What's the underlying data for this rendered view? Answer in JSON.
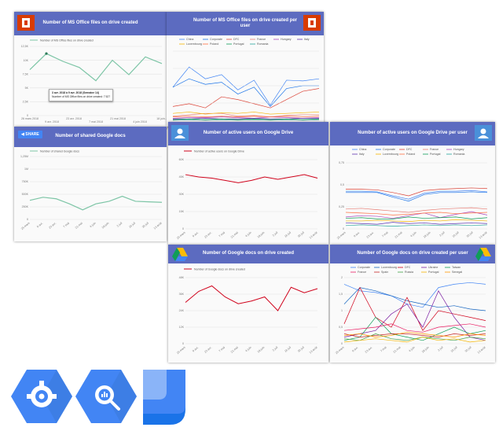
{
  "colors": {
    "header": "#5c6bc0",
    "office": "#d83b01",
    "teal": "#7dc5a6",
    "red": "#d0021b"
  },
  "cards": {
    "ms_office": {
      "title": "Number of MS Office files on drive created",
      "icon": "office-icon"
    },
    "ms_office_user": {
      "title": "Number of MS Office files on drive created per user",
      "icon": "office-icon"
    },
    "shared_docs": {
      "title": "Number of shared Google docs",
      "share_label": "SHARE"
    },
    "active_users": {
      "title": "Number of active users on Google Drive",
      "icon": "user-icon"
    },
    "active_users_per_user": {
      "title": "Number of active users on Google Drive per user",
      "icon": "user-icon"
    },
    "docs_created": {
      "title": "Number of Google docs on drive created",
      "icon": "drive-icon"
    },
    "docs_created_user": {
      "title": "Number of Google docs on drive created per user",
      "icon": "drive-icon"
    }
  },
  "tooltip": {
    "line1": "3 avr. 2018 à 9 avr. 2018 (Semaine 14)",
    "line2": "Number of MS Office files on drive created: 7 527"
  },
  "chart_data": [
    {
      "type": "line",
      "title": "Number of MS Office files on drive created",
      "series": [
        {
          "name": "Number of MS Office files on drive created",
          "values": [
            8.3,
            11.2,
            9.8,
            8.7,
            6.3,
            10.0,
            7.4,
            10.6,
            9.4
          ]
        }
      ],
      "yticks": [
        "0",
        "2,5K",
        "5K",
        "7,5K",
        "10K",
        "12,5K"
      ],
      "ylim": [
        0,
        12.5
      ],
      "xticks": [
        "26 mars 2018",
        "9 avr. 2018",
        "23 avr. 2018",
        "7 mai 2018",
        "21 mai 2018",
        "4 juin 2018",
        "18 juin..."
      ]
    },
    {
      "type": "line",
      "title": "Number of MS Office files on drive created per user",
      "legend": [
        "China",
        "Corporate",
        "DFC",
        "France",
        "Hungary",
        "Italy",
        "Luxembourg",
        "Poland",
        "Portugal",
        "Romania"
      ],
      "ylim": [
        0,
        1
      ]
    },
    {
      "type": "line",
      "title": "Number of shared Google docs",
      "series": [
        {
          "name": "Number of shared Google docs",
          "values": [
            0.38,
            0.44,
            0.41,
            0.31,
            0.19,
            0.31,
            0.36,
            0.46,
            0.36,
            0.35,
            0.34
          ]
        }
      ],
      "yticks": [
        "0",
        "250K",
        "500K",
        "750K",
        "1M",
        "1,25M"
      ],
      "ylim": [
        0,
        1.25
      ]
    },
    {
      "type": "line",
      "title": "Number of active users on Google Drive",
      "series": [
        {
          "name": "Number of active users on Google Drive",
          "values": [
            47,
            45,
            44,
            42,
            40,
            42,
            45,
            43,
            45,
            47,
            44
          ]
        }
      ],
      "yticks": [
        "0",
        "15K",
        "30K",
        "45K",
        "60K"
      ],
      "ylim": [
        0,
        60
      ]
    },
    {
      "type": "line",
      "title": "Number of active users on Google Drive per user",
      "legend": [
        "China",
        "Corporate",
        "DFC",
        "France",
        "Hungary",
        "Italy",
        "Luxembourg",
        "Poland",
        "Portugal",
        "Romania"
      ],
      "yticks": [
        "0",
        "0,25",
        "0,5",
        "0,75"
      ],
      "ylim": [
        0,
        1
      ]
    },
    {
      "type": "line",
      "title": "Number of Google docs on drive created",
      "series": [
        {
          "name": "Number of Google docs on drive created",
          "values": [
            30,
            38,
            42,
            34,
            29,
            31,
            34,
            24,
            41,
            37,
            40
          ]
        }
      ],
      "yticks": [
        "0",
        "12K",
        "24K",
        "36K",
        "48K"
      ],
      "ylim": [
        0,
        48
      ]
    },
    {
      "type": "line",
      "title": "Number of Google docs on drive created per user",
      "legend": [
        "Corporate",
        "Luxembourg",
        "DFC",
        "Ukraine",
        "Taiwan",
        "France",
        "Spain",
        "Russia",
        "Portugal",
        "Senegal"
      ],
      "yticks": [
        "0",
        "0,5",
        "1",
        "1,5",
        "2"
      ],
      "ylim": [
        0,
        2
      ]
    }
  ]
}
